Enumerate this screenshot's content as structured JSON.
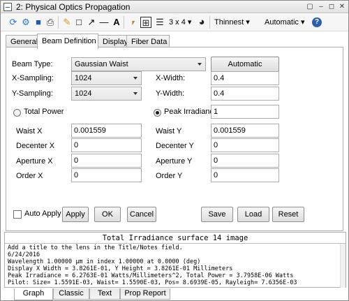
{
  "window": {
    "title": "2: Physical Optics Propagation",
    "controls": [
      "▢",
      "–",
      "◻",
      "✕"
    ]
  },
  "toolbar": {
    "icons": [
      {
        "name": "refresh-icon",
        "glyph": "⟳",
        "color": "#2f76c9"
      },
      {
        "name": "settings-icon",
        "glyph": "⚙",
        "color": "#2f76c9"
      },
      {
        "name": "save-icon",
        "glyph": "■",
        "color": "#2b58a8"
      },
      {
        "name": "print-icon",
        "glyph": "⎙",
        "color": "#333"
      },
      {
        "name": "pencil-icon",
        "glyph": "✎",
        "color": "#d49a1b"
      },
      {
        "name": "rectangle-icon",
        "glyph": "□",
        "color": "#000"
      },
      {
        "name": "arrow-icon",
        "glyph": "↗",
        "color": "#000"
      },
      {
        "name": "line-icon",
        "glyph": "—",
        "color": "#000"
      },
      {
        "name": "text-icon",
        "glyph": "A",
        "color": "#000"
      },
      {
        "name": "lock-icon",
        "glyph": "⎖",
        "color": "#b08a2a"
      },
      {
        "name": "layout-grid-icon",
        "glyph": "⊞",
        "color": "#222"
      },
      {
        "name": "layers-icon",
        "glyph": "☰",
        "color": "#222"
      }
    ],
    "layout_label": "3 x 4 ▾",
    "clock_icon": "◕",
    "line_weight": "Thinnest",
    "scale_mode": "Automatic",
    "help_icon": "?"
  },
  "tabs": [
    "General",
    "Beam Definition",
    "Display",
    "Fiber Data"
  ],
  "active_tab": "Beam Definition",
  "form": {
    "beam_type_label": "Beam Type:",
    "beam_type_value": "Gaussian Waist",
    "automatic_button": "Automatic",
    "x_sampling_label": "X-Sampling:",
    "x_sampling_value": "1024",
    "y_sampling_label": "Y-Sampling:",
    "y_sampling_value": "1024",
    "x_width_label": "X-Width:",
    "x_width_value": "0.4",
    "y_width_label": "Y-Width:",
    "y_width_value": "0.4",
    "total_power_label": "Total Power",
    "peak_irradiance_label": "Peak Irradiance",
    "peak_irradiance_value": "1",
    "selected_power_mode": "Peak Irradiance",
    "waist_x_label": "Waist X",
    "waist_x_value": "0.001559",
    "waist_y_label": "Waist Y",
    "waist_y_value": "0.001559",
    "decenter_x_label": "Decenter X",
    "decenter_x_value": "0",
    "decenter_y_label": "Decenter Y",
    "decenter_y_value": "0",
    "aperture_x_label": "Aperture X",
    "aperture_x_value": "0",
    "aperture_y_label": "Aperture Y",
    "aperture_y_value": "0",
    "order_x_label": "Order X",
    "order_x_value": "0",
    "order_y_label": "Order Y",
    "order_y_value": "0"
  },
  "actions": {
    "auto_apply_label": "Auto Apply",
    "auto_apply_checked": false,
    "apply": "Apply",
    "ok": "OK",
    "cancel": "Cancel",
    "save": "Save",
    "load": "Load",
    "reset": "Reset"
  },
  "report": {
    "title": "Total Irradiance surface 14 image",
    "lines": [
      "Add a title to the lens in the Title/Notes field.",
      "6/24/2016",
      "Wavelength 1.00000 µm in index 1.00000 at 0.0000 (deg)",
      "Display X Width = 3.8261E-01, Y Height = 3.8261E-01 Millimeters",
      "Peak Irradiance = 6.2763E-01 Watts/Millimeters^2, Total Power = 3.7958E-06 Watts",
      "Pilot: Size= 1.5591E-03, Waist= 1.5590E-03, Pos= 8.6939E-05, Rayleigh= 7.6356E-03"
    ]
  },
  "bottom_tabs": [
    "Graph",
    "Classic",
    "Text",
    "Prop Report"
  ],
  "active_bottom_tab": "Graph"
}
